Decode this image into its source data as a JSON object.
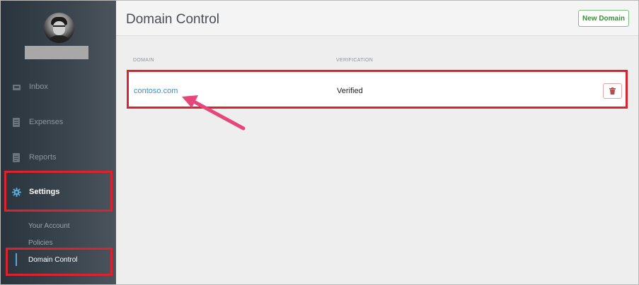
{
  "sidebar": {
    "nav": [
      {
        "label": "Inbox",
        "icon": "inbox-icon"
      },
      {
        "label": "Expenses",
        "icon": "document-icon"
      },
      {
        "label": "Reports",
        "icon": "document-icon"
      },
      {
        "label": "Settings",
        "icon": "gear-icon"
      }
    ],
    "subnav": [
      {
        "label": "Your Account"
      },
      {
        "label": "Policies"
      },
      {
        "label": "Domain Control"
      }
    ]
  },
  "main": {
    "title": "Domain Control",
    "new_domain_label": "New Domain",
    "columns": [
      "DOMAIN",
      "VERIFICATION"
    ],
    "rows": [
      {
        "domain": "contoso.com",
        "verification": "Verified"
      }
    ]
  },
  "colors": {
    "highlight": "#d9232e",
    "arrow": "#e8457a",
    "link": "#3b8fc7",
    "active_accent": "#5aa7d8"
  }
}
